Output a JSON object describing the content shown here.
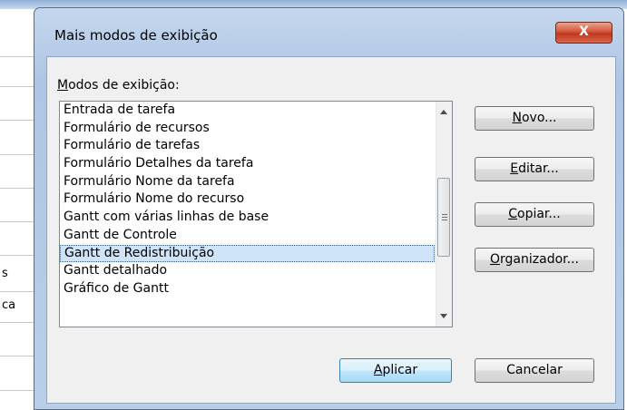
{
  "background": {
    "cells": [
      "s",
      "ca"
    ]
  },
  "dialog": {
    "title": "Mais modos de exibição",
    "close_label": "X",
    "list_label_key": "M",
    "list_label_rest": "odos de exibição:",
    "items": [
      "Entrada de tarefa",
      "Formulário de recursos",
      "Formulário de tarefas",
      "Formulário Detalhes da tarefa",
      "Formulário Nome da tarefa",
      "Formulário Nome do recurso",
      "Gantt com várias linhas de base",
      "Gantt de Controle",
      "Gantt de Redistribuição",
      "Gantt detalhado",
      "Gráfico de Gantt"
    ],
    "selected_index": 8,
    "buttons": {
      "novo_key": "N",
      "novo_rest": "ovo...",
      "editar_key": "E",
      "editar_rest": "ditar...",
      "copiar_key": "C",
      "copiar_rest": "opiar...",
      "organizador_key": "O",
      "organizador_rest": "rganizador...",
      "aplicar_key": "A",
      "aplicar_rest": "plicar",
      "cancelar": "Cancelar"
    }
  }
}
